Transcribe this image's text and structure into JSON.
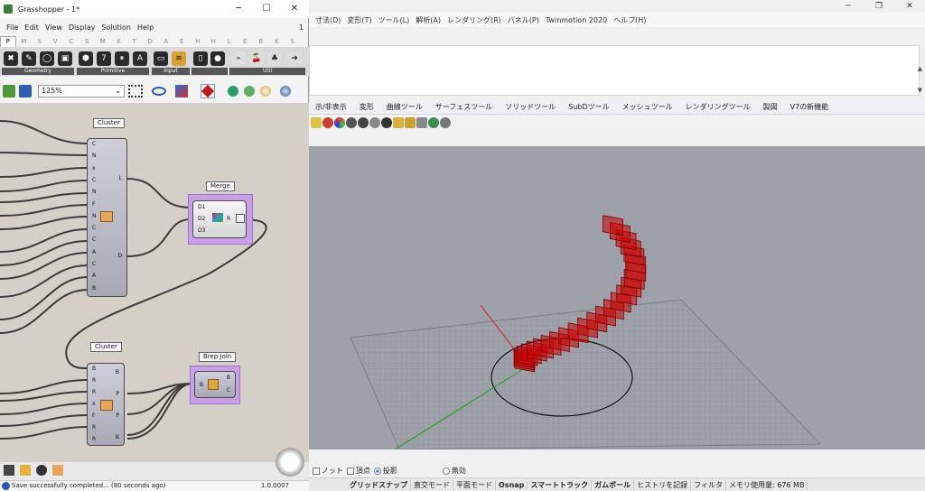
{
  "rhino": {
    "menu": [
      "寸法(D)",
      "変形(T)",
      "ツール(L)",
      "解析(A)",
      "レンダリング(R)",
      "パネル(P)",
      "Twinmotion 2020",
      "ヘルプ(H)"
    ],
    "window_controls": [
      "─",
      "❐",
      "✕"
    ],
    "tabs": [
      "示/非表示",
      "変形",
      "曲線ツール",
      "サーフェスツール",
      "ソリッドツール",
      "SubDツール",
      "メッシュツール",
      "レンダリングツール",
      "製図",
      "V7の新機能"
    ],
    "osnap": {
      "items": [
        "ノット",
        "頂点"
      ],
      "radio_on": "投影",
      "radio_off": "無効"
    },
    "status": [
      "グリッドスナップ",
      "直交モード",
      "平面モード",
      "Osnap",
      "スマートトラック",
      "ガムボール",
      "ヒストリを記録",
      "フィルタ",
      "メモリ使用量: 676 MB"
    ],
    "status_bold": [
      0,
      3,
      4,
      5
    ],
    "accent": "#cc0000"
  },
  "gh": {
    "title": "Grasshopper - 1*",
    "window_controls": [
      "─",
      "☐",
      "✕"
    ],
    "menu": [
      "File",
      "Edit",
      "View",
      "Display",
      "Solution",
      "Help"
    ],
    "menu_num": "1",
    "categories": [
      "P",
      "M",
      "S",
      "V",
      "C",
      "S",
      "M",
      "X",
      "T",
      "D",
      "A",
      "E",
      "H",
      "H",
      "L",
      "E",
      "B",
      "K",
      "S"
    ],
    "active_category": 0,
    "ribbon_groups": [
      {
        "label": "Geometry",
        "icons": [
          "✖",
          "✎",
          "◯",
          "▣"
        ]
      },
      {
        "label": "Primitive",
        "icons": [
          "⬢",
          "7",
          "⏸",
          "A"
        ]
      },
      {
        "label": "Input",
        "icons": [
          "▭",
          "≋"
        ]
      },
      {
        "label": "",
        "icons": [
          "▯",
          "●"
        ]
      },
      {
        "label": "Util",
        "icons": [
          "⌁",
          "🍒",
          "♣",
          "➜"
        ]
      }
    ],
    "zoom": "125%",
    "status": "Save successfully completed... (80 seconds ago)",
    "version": "1.0.0007",
    "cluster1": {
      "tag": "Cluster",
      "inputs": [
        "C",
        "N",
        "x",
        "C",
        "N",
        "F",
        "N",
        "C",
        "C",
        "A",
        "C",
        "A",
        "B"
      ],
      "outputs": [
        "L",
        "D"
      ]
    },
    "merge": {
      "tag": "Merge",
      "inputs": [
        "D1",
        "D2",
        "D3"
      ],
      "output": "R"
    },
    "cluster2": {
      "tag": "Cluster",
      "inputs": [
        "B",
        "R",
        "R",
        "x",
        "F",
        "R",
        "R"
      ],
      "outputs": [
        "B",
        "P",
        "P",
        "B"
      ]
    },
    "brep_join": {
      "tag": "Brep Join",
      "input": "B",
      "outputs": [
        "B",
        "C"
      ]
    }
  }
}
